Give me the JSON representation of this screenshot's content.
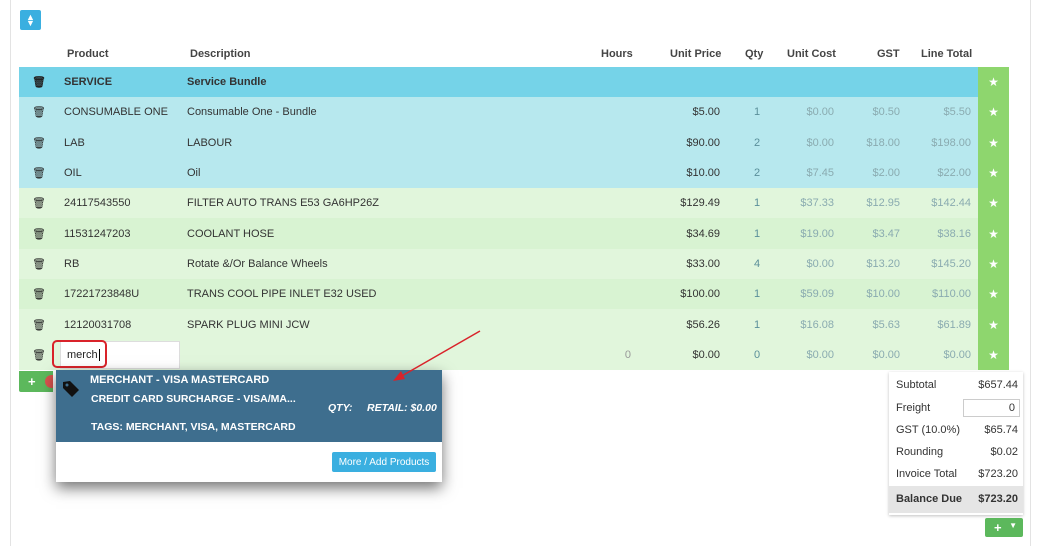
{
  "toolbar": {
    "sort_icon": "sort-arrows-icon"
  },
  "columns": [
    "Product",
    "Description",
    "Hours",
    "Unit Price",
    "Qty",
    "Unit Cost",
    "GST",
    "Line Total"
  ],
  "rows": [
    {
      "type": "bundle",
      "product": "SERVICE",
      "description": "Service Bundle",
      "hours": "",
      "unit_price": "",
      "qty": "",
      "unit_cost": "",
      "gst": "",
      "line_total": ""
    },
    {
      "type": "bundle-item",
      "product": "CONSUMABLE ONE",
      "description": "Consumable One - Bundle",
      "hours": "",
      "unit_price": "$5.00",
      "qty": "1",
      "unit_cost": "$0.00",
      "gst": "$0.50",
      "line_total": "$5.50"
    },
    {
      "type": "bundle-item",
      "product": "LAB",
      "description": "LABOUR",
      "hours": "",
      "unit_price": "$90.00",
      "qty": "2",
      "unit_cost": "$0.00",
      "gst": "$18.00",
      "line_total": "$198.00"
    },
    {
      "type": "bundle-item",
      "product": "OIL",
      "description": "Oil",
      "hours": "",
      "unit_price": "$10.00",
      "qty": "2",
      "unit_cost": "$7.45",
      "gst": "$2.00",
      "line_total": "$22.00"
    },
    {
      "type": "std",
      "product": "24117543550",
      "description": "FILTER AUTO TRANS E53 GA6HP26Z",
      "hours": "",
      "unit_price": "$129.49",
      "qty": "1",
      "unit_cost": "$37.33",
      "gst": "$12.95",
      "line_total": "$142.44"
    },
    {
      "type": "std",
      "product": "11531247203",
      "description": "COOLANT HOSE",
      "hours": "",
      "unit_price": "$34.69",
      "qty": "1",
      "unit_cost": "$19.00",
      "gst": "$3.47",
      "line_total": "$38.16"
    },
    {
      "type": "std",
      "product": "RB",
      "description": "Rotate &/Or Balance Wheels",
      "hours": "",
      "unit_price": "$33.00",
      "qty": "4",
      "unit_cost": "$0.00",
      "gst": "$13.20",
      "line_total": "$145.20"
    },
    {
      "type": "std",
      "product": "17221723848U",
      "description": "TRANS COOL PIPE INLET E32 USED",
      "hours": "",
      "unit_price": "$100.00",
      "qty": "1",
      "unit_cost": "$59.09",
      "gst": "$10.00",
      "line_total": "$110.00"
    },
    {
      "type": "std",
      "product": "12120031708",
      "description": "SPARK PLUG MINI JCW",
      "hours": "",
      "unit_price": "$56.26",
      "qty": "1",
      "unit_cost": "$16.08",
      "gst": "$5.63",
      "line_total": "$61.89"
    }
  ],
  "entry_row": {
    "input_value": "merch",
    "hours": "0",
    "unit_price": "$0.00",
    "qty": "0",
    "unit_cost": "$0.00",
    "gst": "$0.00",
    "line_total": "$0.00"
  },
  "dropdown": {
    "name": "MERCHANT - VISA MASTERCARD",
    "sub": "CREDIT CARD SURCHARGE - VISA/MA...",
    "qty_label": "QTY:",
    "retail_label": "RETAIL: $0.00",
    "tags_label": "TAGS:",
    "tags_value": "MERCHANT, VISA, MASTERCARD",
    "more_button": "More / Add Products"
  },
  "totals": {
    "subtotal_label": "Subtotal",
    "subtotal": "$657.44",
    "freight_label": "Freight",
    "freight": "0",
    "gst_label": "GST (10.0%)",
    "gst": "$65.74",
    "rounding_label": "Rounding",
    "rounding": "$0.02",
    "invoice_label": "Invoice Total",
    "invoice": "$723.20",
    "balance_label": "Balance Due",
    "balance": "$723.20"
  },
  "colors": {
    "bundle": "#75d3e8",
    "bundle_item": "#b7e8ee",
    "standard": "#e1f6dc",
    "star": "#8ed66e",
    "dropdown": "#3e6e8e",
    "annotation": "#d9232a"
  }
}
